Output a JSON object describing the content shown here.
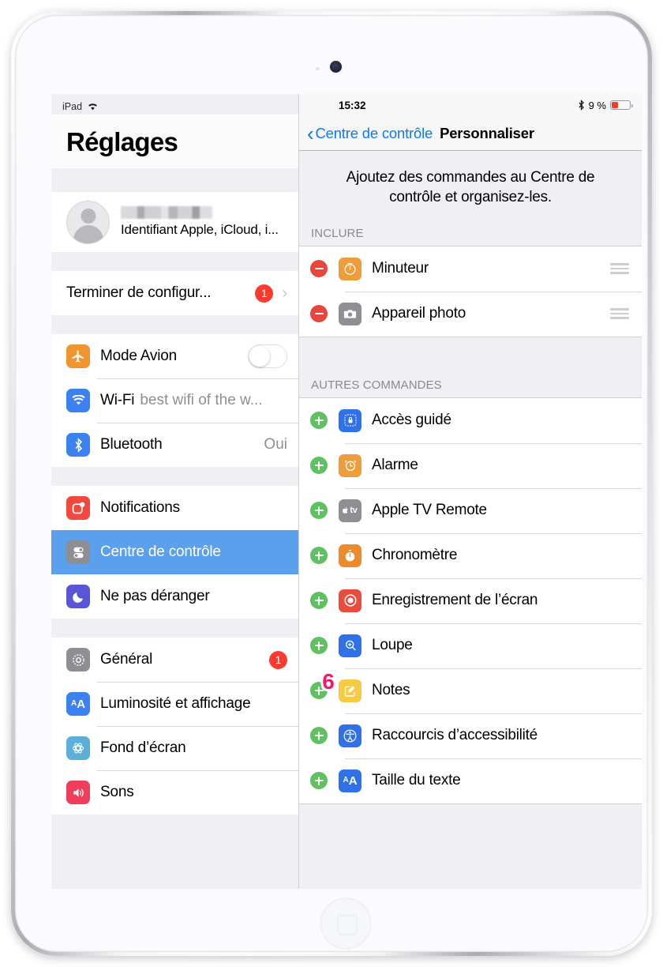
{
  "device": {
    "name": "iPad"
  },
  "left": {
    "status": {
      "device_label": "iPad",
      "wifi_icon": "wifi-icon"
    },
    "title": "Réglages",
    "account": {
      "name_redacted": "",
      "subtitle": "Identifiant Apple, iCloud, i..."
    },
    "setup_row": {
      "label": "Terminer de configur...",
      "badge": "1",
      "chevron": "›"
    },
    "groups": [
      {
        "rows": [
          {
            "label": "Mode Avion",
            "icon": "airplane-icon",
            "icon_color": "#f0942f",
            "control": "toggle",
            "toggle_on": false
          },
          {
            "label": "Wi-Fi",
            "icon": "wifi-square-icon",
            "icon_color": "#3b82f0",
            "sub": "best wifi of the w..."
          },
          {
            "label": "Bluetooth",
            "icon": "bluetooth-icon",
            "icon_color": "#3b82f0",
            "value": "Oui"
          }
        ]
      },
      {
        "rows": [
          {
            "label": "Notifications",
            "icon": "notifications-icon",
            "icon_color": "#f4483c"
          },
          {
            "label": "Centre de contrôle",
            "icon": "control-center-icon",
            "icon_color": "#8e8e93",
            "selected": true
          },
          {
            "label": "Ne pas déranger",
            "icon": "moon-icon",
            "icon_color": "#5855d6"
          }
        ]
      },
      {
        "rows": [
          {
            "label": "Général",
            "icon": "gear-icon",
            "icon_color": "#8e8e93",
            "badge": "1"
          },
          {
            "label": "Luminosité et affichage",
            "icon": "text-size-icon",
            "icon_color": "#3b82f0"
          },
          {
            "label": "Fond d’écran",
            "icon": "wallpaper-icon",
            "icon_color": "#5ab0d8"
          },
          {
            "label": "Sons",
            "icon": "speaker-icon",
            "icon_color": "#ef3d5c"
          }
        ]
      }
    ]
  },
  "right": {
    "status": {
      "time": "15:32",
      "bluetooth_icon": "bluetooth-icon",
      "battery_percent": "9 %",
      "battery_level": 9
    },
    "nav": {
      "back_label": "Centre de contrôle",
      "back_chevron": "‹",
      "title": "Personnaliser"
    },
    "intro": "Ajoutez des commandes au Centre de contrôle et organisez-les.",
    "sections": [
      {
        "header": "INCLURE",
        "rows": [
          {
            "label": "Minuteur",
            "action": "remove",
            "icon": "timer-icon",
            "icon_color": "#ef9c3a",
            "reorder": true
          },
          {
            "label": "Appareil photo",
            "action": "remove",
            "icon": "camera-icon",
            "icon_color": "#8e8e93",
            "reorder": true
          }
        ]
      },
      {
        "header": "AUTRES COMMANDES",
        "rows": [
          {
            "label": "Accès guidé",
            "action": "add",
            "icon": "guided-access-lock-icon",
            "icon_color": "#2f72e8"
          },
          {
            "label": "Alarme",
            "action": "add",
            "icon": "alarm-clock-icon",
            "icon_color": "#ef9c3a"
          },
          {
            "label": "Apple TV Remote",
            "action": "add",
            "icon": "apple-tv-icon",
            "icon_color": "#8e8e93"
          },
          {
            "label": "Chronomètre",
            "action": "add",
            "icon": "stopwatch-icon",
            "icon_color": "#ef8a2a"
          },
          {
            "label": "Enregistrement de l’écran",
            "action": "add",
            "icon": "screen-record-icon",
            "icon_color": "#ea4b3c"
          },
          {
            "label": "Loupe",
            "action": "add",
            "icon": "magnifier-icon",
            "icon_color": "#2f72e8"
          },
          {
            "label": "Notes",
            "action": "add",
            "icon": "notes-icon",
            "icon_color": "#f5cb45"
          },
          {
            "label": "Raccourcis d’accessibilité",
            "action": "add",
            "icon": "accessibility-icon",
            "icon_color": "#2f72e8"
          },
          {
            "label": "Taille du texte",
            "action": "add",
            "icon": "text-size-icon",
            "icon_color": "#2f72e8"
          }
        ]
      }
    ]
  },
  "annotations": [
    {
      "label": "6",
      "color": "#f5176a"
    }
  ]
}
